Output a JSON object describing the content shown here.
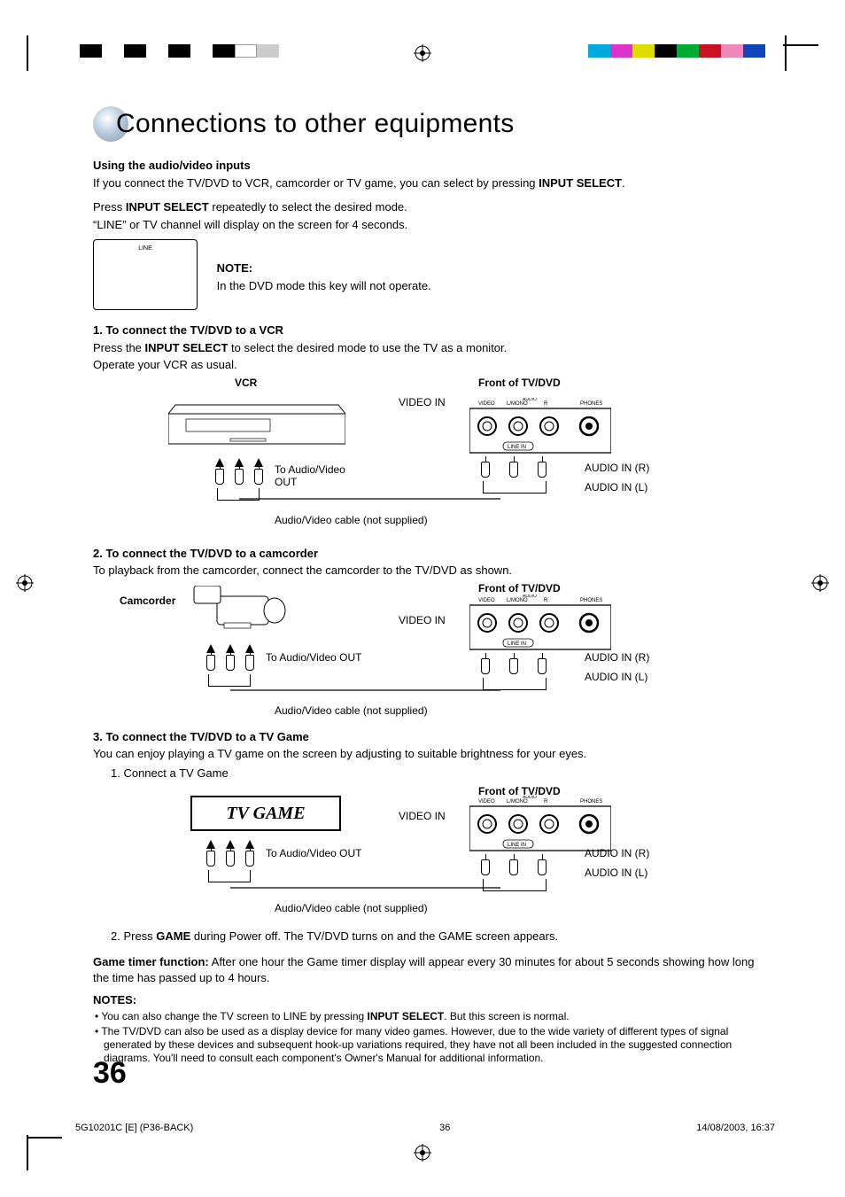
{
  "title": "Connections to other equipments",
  "section_using": {
    "heading": "Using the audio/video inputs",
    "p1a": "If you connect the TV/DVD to VCR, camcorder or TV game, you can select by pressing ",
    "p1b": "INPUT SELECT",
    "p1c": ".",
    "p2a": "Press ",
    "p2b": "INPUT SELECT",
    "p2c": " repeatedly to select the desired mode.",
    "p3": "“LINE” or TV channel will display on the screen for 4 seconds.",
    "screen_text": "LINE",
    "note_heading": "NOTE:",
    "note_body": "In the DVD mode this key will not operate."
  },
  "sec1": {
    "heading": "1. To connect the TV/DVD to a VCR",
    "p1a": "Press the ",
    "p1b": "INPUT SELECT",
    "p1c": " to select the desired mode to use the TV as a monitor.",
    "p2": "Operate your VCR as usual."
  },
  "sec2": {
    "heading": "2. To connect the TV/DVD to a camcorder",
    "p1": "To playback from the camcorder, connect the camcorder to the TV/DVD as shown."
  },
  "sec3": {
    "heading": "3. To connect the TV/DVD to a TV Game",
    "p1": "You can enjoy playing a TV game on the screen by adjusting to suitable brightness for your eyes.",
    "step1": "1. Connect a TV Game",
    "step2a": "2. Press ",
    "step2b": "GAME",
    "step2c": " during Power off. The TV/DVD turns on and the GAME screen appears."
  },
  "diagram": {
    "vcr_label": "VCR",
    "front_label": "Front of TV/DVD",
    "camcorder_label": "Camcorder",
    "tvgame_label": "TV GAME",
    "video_in": "VIDEO IN",
    "to_av_out": "To Audio/Video OUT",
    "to_av_out_short": "To Audio/Video OUT",
    "audio_in_r": "AUDIO IN (R)",
    "audio_in_l": "AUDIO IN (L)",
    "cable_note": "Audio/Video cable (not supplied)",
    "panel": {
      "video": "VIDEO",
      "audio": "AUDIO",
      "lmono": "L/MONO",
      "r": "R",
      "phones": "PHONES",
      "line_in": "LINE IN"
    }
  },
  "game_timer": {
    "label": "Game timer function:",
    "body": " After one hour the Game timer display will appear every 30 minutes for about 5 seconds showing how long the time has passed up to 4 hours."
  },
  "notes": {
    "heading": "NOTES:",
    "n1a": "• You can also change the TV screen to LINE by pressing ",
    "n1b": "INPUT SELECT",
    "n1c": ". But this screen is normal.",
    "n2": "• The TV/DVD can also be used as a display device for many video games. However, due to the wide variety of different types of signal generated by these devices and subsequent hook-up variations required, they have not all been included in the suggested connection diagrams. You'll need to consult each component's Owner's Manual for additional information."
  },
  "page_number": "36",
  "footer": {
    "left": "5G10201C [E] (P36-BACK)",
    "mid": "36",
    "right": "14/08/2003, 16:37"
  }
}
